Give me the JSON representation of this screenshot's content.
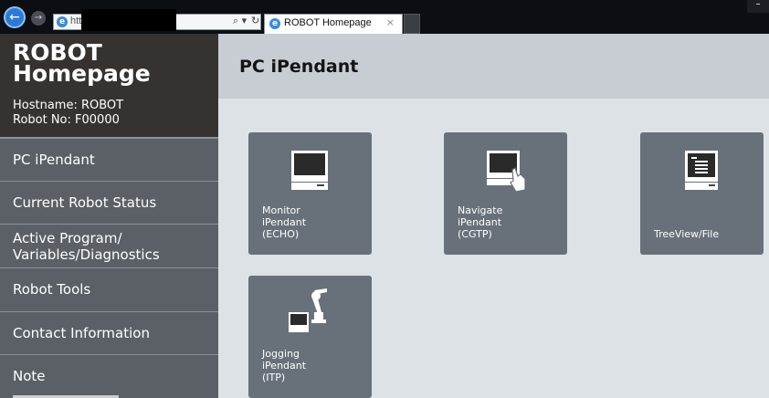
{
  "browser": {
    "address_text": "http",
    "tab_title": "ROBOT Homepage",
    "tab_close": "×",
    "search_glyph": "⌕ ▾",
    "refresh_glyph": "↻",
    "minimize_glyph": "–"
  },
  "sidebar": {
    "title": "ROBOT Homepage",
    "hostname": "Hostname: ROBOT",
    "robot_no": "Robot No: F00000",
    "items": [
      {
        "label": "PC iPendant"
      },
      {
        "label": "Current Robot Status"
      },
      {
        "label": "Active Program/\nVariables/Diagnostics"
      },
      {
        "label": "Robot Tools"
      },
      {
        "label": "Contact Information"
      },
      {
        "label": "Note"
      }
    ]
  },
  "main": {
    "title": "PC iPendant",
    "tiles": [
      {
        "label": "Monitor\niPendant\n(ECHO)",
        "icon": "monitor-icon"
      },
      {
        "label": "Navigate\niPendant\n(CGTP)",
        "icon": "touch-monitor-icon"
      },
      {
        "label": "TreeView/File",
        "icon": "tree-file-icon"
      },
      {
        "label": "Jogging\niPendant\n(ITP)",
        "icon": "robot-arm-icon"
      }
    ]
  },
  "colors": {
    "sidebar_bg": "#5a6066",
    "brand_bg": "#363230",
    "tile_bg": "#68717a",
    "main_bg": "#dde2e7",
    "header_bg": "#c7cdd3"
  }
}
